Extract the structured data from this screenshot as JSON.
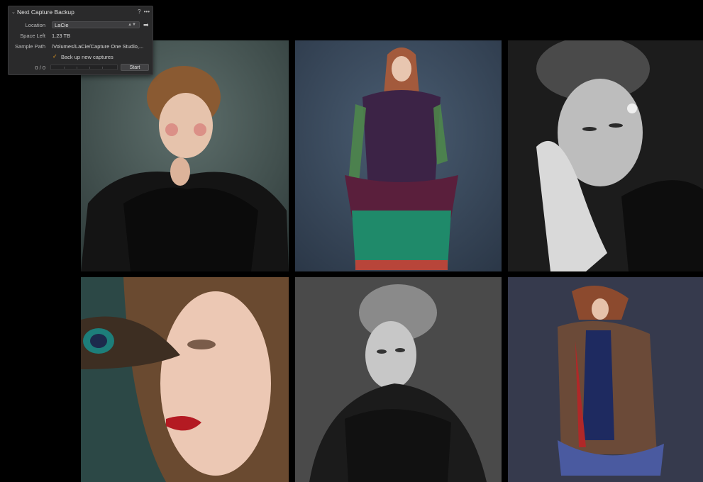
{
  "panel": {
    "title": "Next Capture Backup",
    "help": "?",
    "more": "•••",
    "location_label": "Location",
    "location_value": "LaCie",
    "space_left_label": "Space Left",
    "space_left_value": "1.23 TB",
    "sample_path_label": "Sample Path",
    "sample_path_value": "/Volumes/LaCie/Capture One Studio,...",
    "checkbox_label": "Back up new captures",
    "checkbox_checked": true,
    "count": "0 / 0",
    "progress": 0,
    "start_label": "Start"
  },
  "photos": [
    {
      "name": "photo-red-haired-fur-coat",
      "bg": "#4b5a58",
      "tone": "color"
    },
    {
      "name": "photo-embroidered-dress",
      "bg": "#3a4c5e",
      "tone": "color"
    },
    {
      "name": "photo-bw-sleeping-portrait",
      "bg": "#222222",
      "tone": "bw"
    },
    {
      "name": "photo-peacock-feather-closeup",
      "bg": "#32504f",
      "tone": "color"
    },
    {
      "name": "photo-bw-lace-portrait",
      "bg": "#4a4a4a",
      "tone": "bw"
    },
    {
      "name": "photo-fur-coat-wind",
      "bg": "#3c4054",
      "tone": "color"
    }
  ],
  "colors": {
    "background": "#000000",
    "panel_bg": "#2a2a2b",
    "accent_check": "#f0a020"
  }
}
